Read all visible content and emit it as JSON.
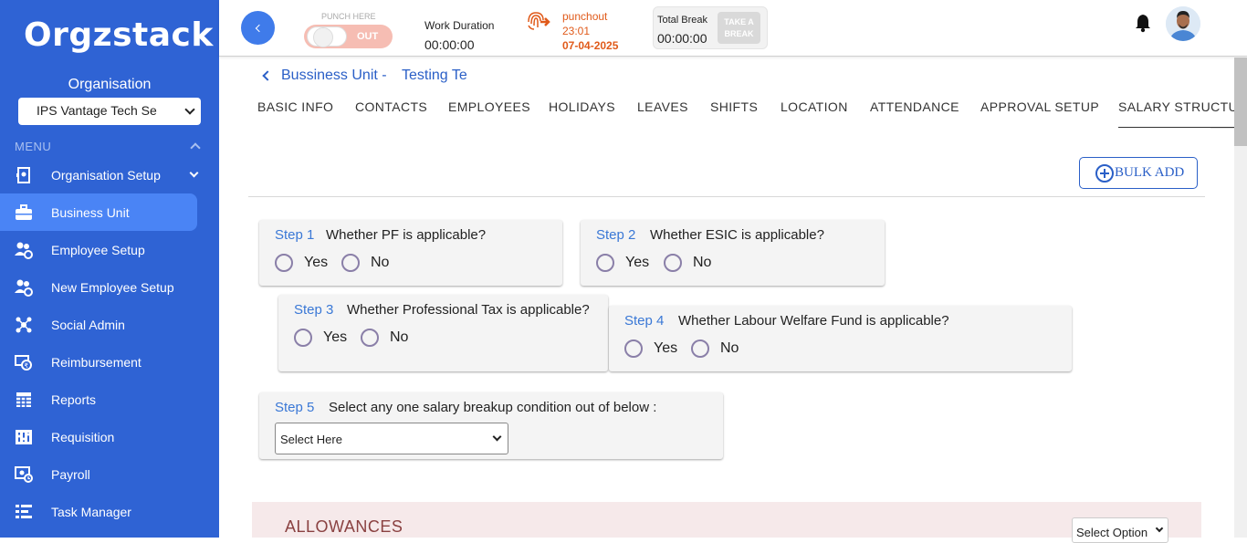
{
  "brand": {
    "logo_text": "Orgzstack"
  },
  "sidebar": {
    "org_label": "Organisation",
    "org_select_value": "IPS Vantage Tech Se",
    "menu_label": "MENU",
    "items": [
      {
        "label": "Organisation Setup",
        "icon": "org-setup-icon",
        "has_arrow": true
      },
      {
        "label": "Business Unit",
        "icon": "briefcase-icon",
        "active": true
      },
      {
        "label": "Employee Setup",
        "icon": "users-gear-icon"
      },
      {
        "label": "New Employee Setup",
        "icon": "users-gear-icon"
      },
      {
        "label": "Social Admin",
        "icon": "social-icon"
      },
      {
        "label": "Reimbursement",
        "icon": "reimbursement-icon"
      },
      {
        "label": "Reports",
        "icon": "reports-grid-icon"
      },
      {
        "label": "Requisition",
        "icon": "requisition-icon"
      },
      {
        "label": "Payroll",
        "icon": "payroll-icon"
      },
      {
        "label": "Task Manager",
        "icon": "task-list-icon"
      }
    ],
    "colors": {
      "bg": "#2f63d4",
      "active": "#4a84f5"
    }
  },
  "topbar": {
    "punch_here": "PUNCH HERE",
    "punch_toggle_label": "OUT",
    "work_duration_label": "Work Duration",
    "work_duration_value": "00:00:00",
    "punchout_label": "punchout",
    "punchout_time": "23:01",
    "punchout_date": "07-04-2025",
    "total_break_label": "Total Break",
    "total_break_value": "00:00:00",
    "take_break_line1": "TAKE A",
    "take_break_line2": "BREAK"
  },
  "breadcrumb": {
    "part1": "Bussiness Unit -",
    "part2": "Testing Te"
  },
  "tabs": [
    {
      "label": "BASIC INFO"
    },
    {
      "label": "CONTACTS"
    },
    {
      "label": "EMPLOYEES"
    },
    {
      "label": "HOLIDAYS"
    },
    {
      "label": "LEAVES"
    },
    {
      "label": "SHIFTS"
    },
    {
      "label": "LOCATION"
    },
    {
      "label": "ATTENDANCE"
    },
    {
      "label": "APPROVAL SETUP"
    },
    {
      "label": "SALARY STRUCTURE",
      "active": true
    }
  ],
  "bulk_add_label": "BULK ADD",
  "steps": [
    {
      "num": "Step 1",
      "question": "Whether PF is applicable?",
      "yes": "Yes",
      "no": "No"
    },
    {
      "num": "Step 2",
      "question": "Whether ESIC is applicable?",
      "yes": "Yes",
      "no": "No"
    },
    {
      "num": "Step 3",
      "question": "Whether Professional Tax is applicable?",
      "yes": "Yes",
      "no": "No"
    },
    {
      "num": "Step 4",
      "question": "Whether Labour Welfare Fund is applicable?",
      "yes": "Yes",
      "no": "No"
    },
    {
      "num": "Step 5",
      "question": "Select any one salary breakup condition out of below :",
      "select_value": "Select Here"
    }
  ],
  "allowances": {
    "title": "ALLOWANCES",
    "select_value": "Select Option"
  }
}
